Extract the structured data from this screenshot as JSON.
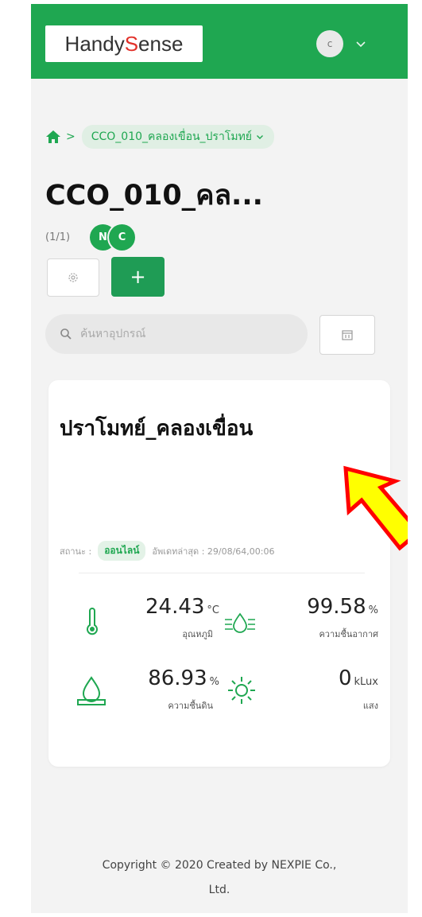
{
  "header": {
    "logo_prefix": "Handy",
    "logo_highlight": "S",
    "logo_suffix": "ense",
    "avatar_initial": "c"
  },
  "breadcrumb": {
    "home_icon": "home-icon",
    "separator": ">",
    "current": "CCO_010_คลองเขื่อน_ปราโมทย์"
  },
  "page": {
    "title": "CCO_010_คล...",
    "count": "(1/1)",
    "badges": [
      "N",
      "C"
    ],
    "add_label": "+"
  },
  "search": {
    "placeholder": "ค้นหาอุปกรณ์"
  },
  "device_card": {
    "name": "ปราโมทย์_คลองเขื่อน",
    "status_label": "สถานะ :",
    "status_value": "ออนไลน์",
    "updated_label": "อัพเดทล่าสุด : 29/08/64,00:06",
    "sensors": [
      {
        "value": "24.43",
        "unit": "°C",
        "label": "อุณหภูมิ",
        "icon": "thermometer-icon"
      },
      {
        "value": "99.58",
        "unit": "%",
        "label": "ความชื้นอากาศ",
        "icon": "air-humidity-icon"
      },
      {
        "value": "86.93",
        "unit": "%",
        "label": "ความชื้นดิน",
        "icon": "soil-moisture-icon"
      },
      {
        "value": "0",
        "unit": "kLux",
        "label": "แสง",
        "icon": "sun-icon"
      }
    ]
  },
  "footer": {
    "line1": "Copyright © 2020 Created by NEXPIE Co.,",
    "line2": "Ltd."
  },
  "colors": {
    "brand_green": "#1fa751",
    "logo_red": "#e2322b",
    "cursor_yellow": "#ffff00",
    "cursor_red": "#ff0000"
  }
}
